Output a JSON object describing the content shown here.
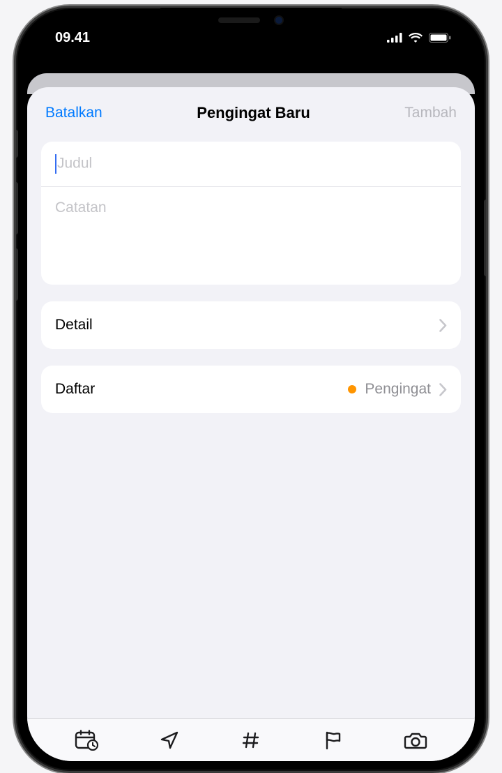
{
  "status": {
    "time": "09.41"
  },
  "header": {
    "cancel": "Batalkan",
    "title": "Pengingat Baru",
    "add": "Tambah"
  },
  "fields": {
    "title_placeholder": "Judul",
    "notes_placeholder": "Catatan"
  },
  "rows": {
    "detail": {
      "label": "Detail"
    },
    "list": {
      "label": "Daftar",
      "value": "Pengingat",
      "dot_color": "#ff9500"
    }
  },
  "toolbar": {
    "icons": [
      "calendar-clock-icon",
      "location-icon",
      "tag-icon",
      "flag-icon",
      "camera-icon"
    ]
  }
}
